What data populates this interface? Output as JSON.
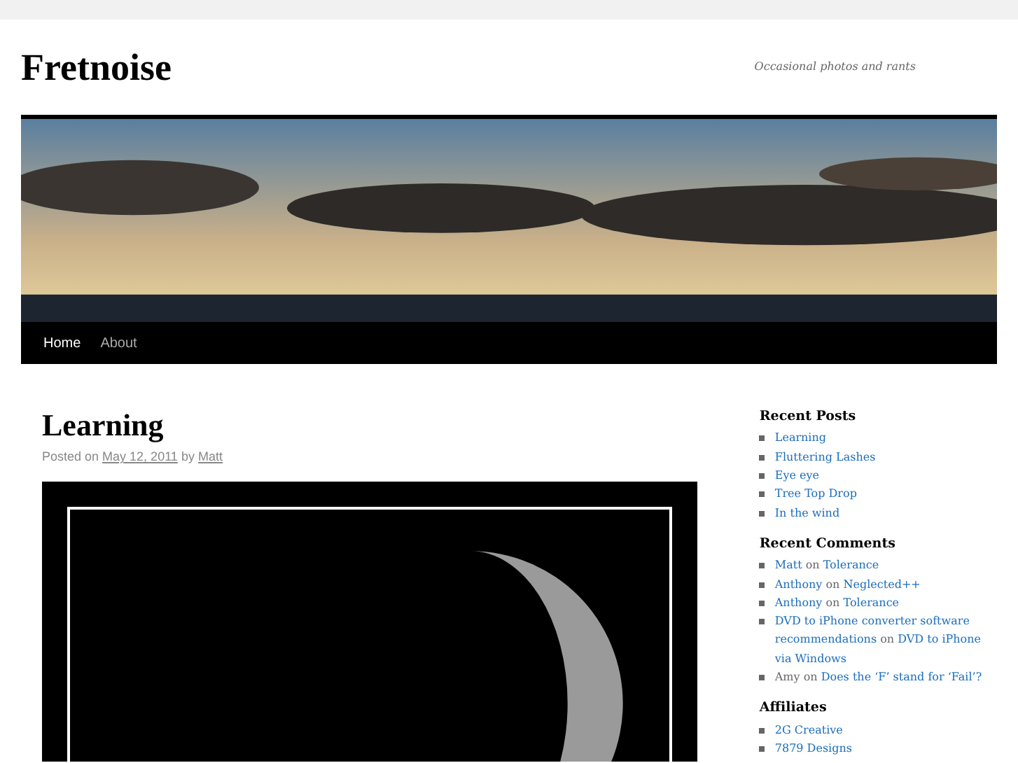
{
  "site": {
    "title": "Fretnoise",
    "tagline": "Occasional photos and rants"
  },
  "nav": [
    {
      "label": "Home",
      "selected": true
    },
    {
      "label": "About",
      "selected": false
    }
  ],
  "post": {
    "title": "Learning",
    "meta": [
      {
        "text": "Posted on",
        "link": false
      },
      {
        "text": "May 12, 2011",
        "link": true
      },
      {
        "text": "by",
        "link": false
      },
      {
        "text": "Matt",
        "link": true
      }
    ]
  },
  "sidebar": [
    {
      "heading": "Recent Posts",
      "items": [
        [
          {
            "text": "Learning",
            "link": true
          }
        ],
        [
          {
            "text": "Fluttering Lashes",
            "link": true
          }
        ],
        [
          {
            "text": "Eye eye",
            "link": true
          }
        ],
        [
          {
            "text": "Tree Top Drop",
            "link": true
          }
        ],
        [
          {
            "text": "In the wind",
            "link": true
          }
        ]
      ]
    },
    {
      "heading": "Recent Comments",
      "items": [
        [
          {
            "text": "Matt",
            "link": true
          },
          {
            "text": "on",
            "link": false
          },
          {
            "text": "Tolerance",
            "link": true
          }
        ],
        [
          {
            "text": "Anthony",
            "link": true
          },
          {
            "text": "on",
            "link": false
          },
          {
            "text": "Neglected++",
            "link": true
          }
        ],
        [
          {
            "text": "Anthony",
            "link": true
          },
          {
            "text": "on",
            "link": false
          },
          {
            "text": "Tolerance",
            "link": true
          }
        ],
        [
          {
            "text": "DVD to iPhone converter software recommendations",
            "link": true
          },
          {
            "text": "on",
            "link": false
          },
          {
            "text": "DVD to iPhone via Windows",
            "link": true
          }
        ],
        [
          {
            "text": "Amy",
            "link": false
          },
          {
            "text": "on",
            "link": false
          },
          {
            "text": "Does the ‘F’ stand for ‘Fail’?",
            "link": true
          }
        ]
      ]
    },
    {
      "heading": "Affiliates",
      "items": [
        [
          {
            "text": "2G Creative",
            "link": true
          }
        ],
        [
          {
            "text": "7879 Designs",
            "link": true
          }
        ]
      ]
    }
  ]
}
